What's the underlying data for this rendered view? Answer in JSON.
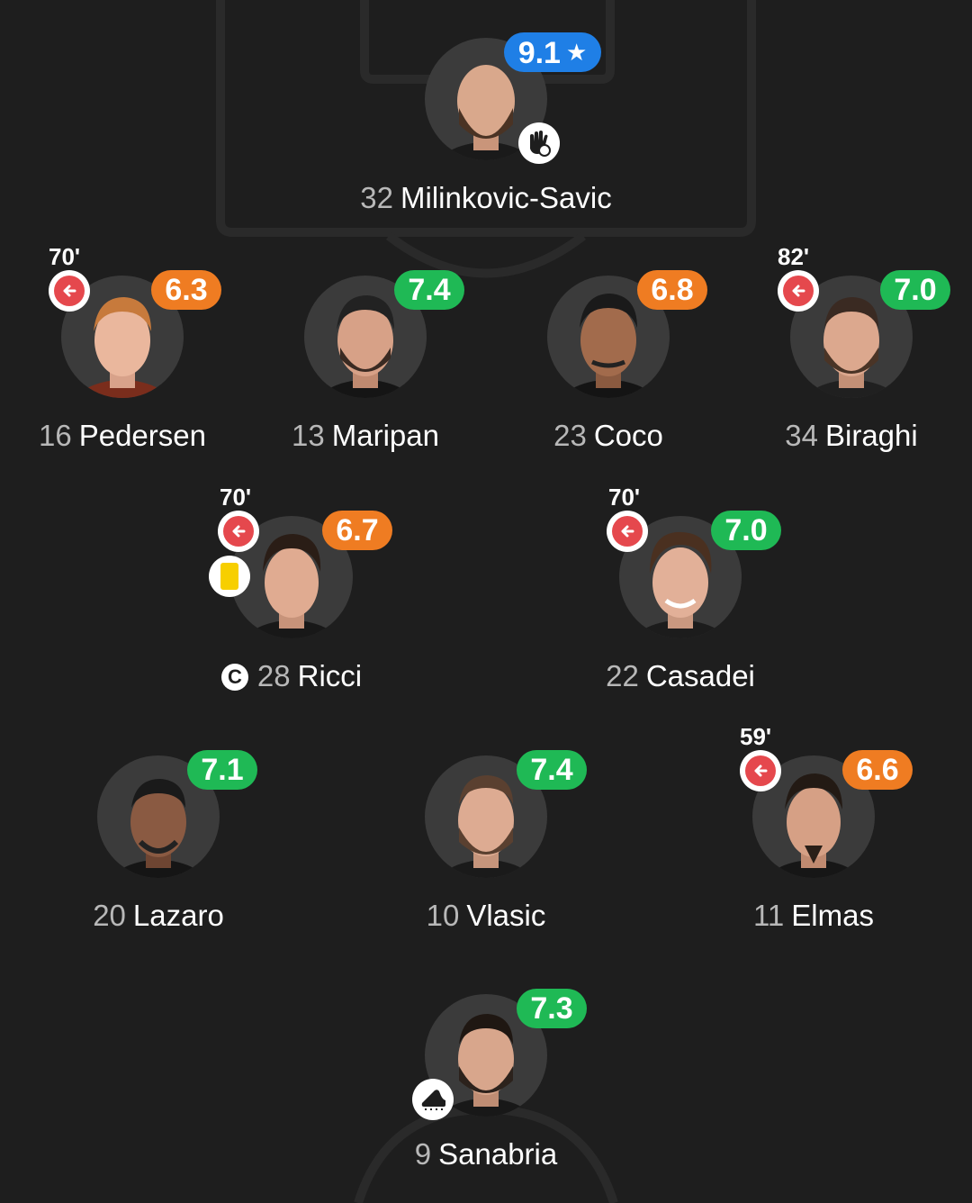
{
  "colors": {
    "background": "#1e1e1e",
    "pitch_lines": "#2a2a2a",
    "rating_green": "#1fb955",
    "rating_orange": "#ef7c22",
    "rating_blue": "#1f7fe6",
    "sub_red": "#e5484d",
    "yellow_card": "#f7cf00"
  },
  "players": [
    {
      "number": "32",
      "name": "Milinkovic-Savic",
      "rating": "9.1",
      "rating_color": "blue",
      "star_icon": "star-icon",
      "badge_icon": "goalkeeper-glove-icon"
    },
    {
      "number": "16",
      "name": "Pedersen",
      "rating": "6.3",
      "rating_color": "orange",
      "sub_time": "70'",
      "sub_icon": "substitution-out-arrow-icon"
    },
    {
      "number": "13",
      "name": "Maripan",
      "rating": "7.4",
      "rating_color": "green"
    },
    {
      "number": "23",
      "name": "Coco",
      "rating": "6.8",
      "rating_color": "orange"
    },
    {
      "number": "34",
      "name": "Biraghi",
      "rating": "7.0",
      "rating_color": "green",
      "sub_time": "82'",
      "sub_icon": "substitution-out-arrow-icon"
    },
    {
      "number": "28",
      "name": "Ricci",
      "rating": "6.7",
      "rating_color": "orange",
      "sub_time": "70'",
      "sub_icon": "substitution-out-arrow-icon",
      "card": "yellow-card",
      "captain_mark": "C"
    },
    {
      "number": "22",
      "name": "Casadei",
      "rating": "7.0",
      "rating_color": "green",
      "sub_time": "70'",
      "sub_icon": "substitution-out-arrow-icon"
    },
    {
      "number": "20",
      "name": "Lazaro",
      "rating": "7.1",
      "rating_color": "green"
    },
    {
      "number": "10",
      "name": "Vlasic",
      "rating": "7.4",
      "rating_color": "green"
    },
    {
      "number": "11",
      "name": "Elmas",
      "rating": "6.6",
      "rating_color": "orange",
      "sub_time": "59'",
      "sub_icon": "substitution-out-arrow-icon"
    },
    {
      "number": "9",
      "name": "Sanabria",
      "rating": "7.3",
      "rating_color": "green",
      "badge_icon": "football-boot-icon"
    }
  ]
}
